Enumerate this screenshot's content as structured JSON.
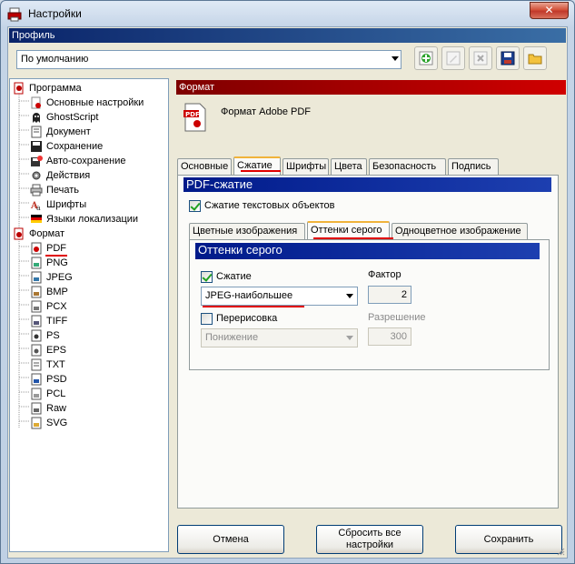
{
  "window": {
    "title": "Настройки",
    "close_label": "✕"
  },
  "profile": {
    "section_label": "Профиль",
    "selected": "По умолчанию",
    "toolbar": [
      {
        "name": "add-profile-button",
        "icon": "plus-green-icon"
      },
      {
        "name": "rename-profile-button",
        "icon": "rename-disabled-icon"
      },
      {
        "name": "delete-profile-button",
        "icon": "delete-disabled-icon"
      },
      {
        "name": "save-profile-button",
        "icon": "floppy-disk-icon"
      },
      {
        "name": "open-profile-button",
        "icon": "folder-icon"
      }
    ]
  },
  "tree": {
    "program": {
      "label": "Программа",
      "children": [
        "Основные настройки",
        "GhostScript",
        "Документ",
        "Сохранение",
        "Авто-сохранение",
        "Действия",
        "Печать",
        "Шрифты",
        "Языки локализации"
      ]
    },
    "format": {
      "label": "Формат",
      "children": [
        "PDF",
        "PNG",
        "JPEG",
        "BMP",
        "PCX",
        "TIFF",
        "PS",
        "EPS",
        "TXT",
        "PSD",
        "PCL",
        "Raw",
        "SVG"
      ]
    }
  },
  "format_panel": {
    "section_label": "Формат",
    "title": "Формат Adobe PDF",
    "tabs": [
      "Основные",
      "Сжатие",
      "Шрифты",
      "Цвета",
      "Безопасность",
      "Подпись"
    ],
    "active_tab": "Сжатие"
  },
  "compression": {
    "header": "PDF-сжатие",
    "compress_text_label": "Сжатие текстовых объектов",
    "compress_text_checked": true,
    "subtabs": [
      "Цветные изображения",
      "Оттенки серого",
      "Одноцветное изображение"
    ],
    "active_subtab": "Оттенки серого",
    "group": {
      "header": "Оттенки серого",
      "compress_label": "Сжатие",
      "compress_checked": true,
      "method_value": "JPEG-наибольшее",
      "factor_label": "Фактор",
      "factor_value": "2",
      "resample_label": "Перерисовка",
      "resample_checked": false,
      "resample_method": "Понижение",
      "resolution_label": "Разрешение",
      "resolution_value": "300"
    }
  },
  "buttons": {
    "cancel": "Отмена",
    "reset": "Сбросить все настройки",
    "save": "Сохранить"
  },
  "colors": {
    "profile_bar": "#0a246a",
    "format_bar": "#b00000",
    "pdf_header": "#0a2a9a",
    "highlight_underline": "#e00000"
  }
}
